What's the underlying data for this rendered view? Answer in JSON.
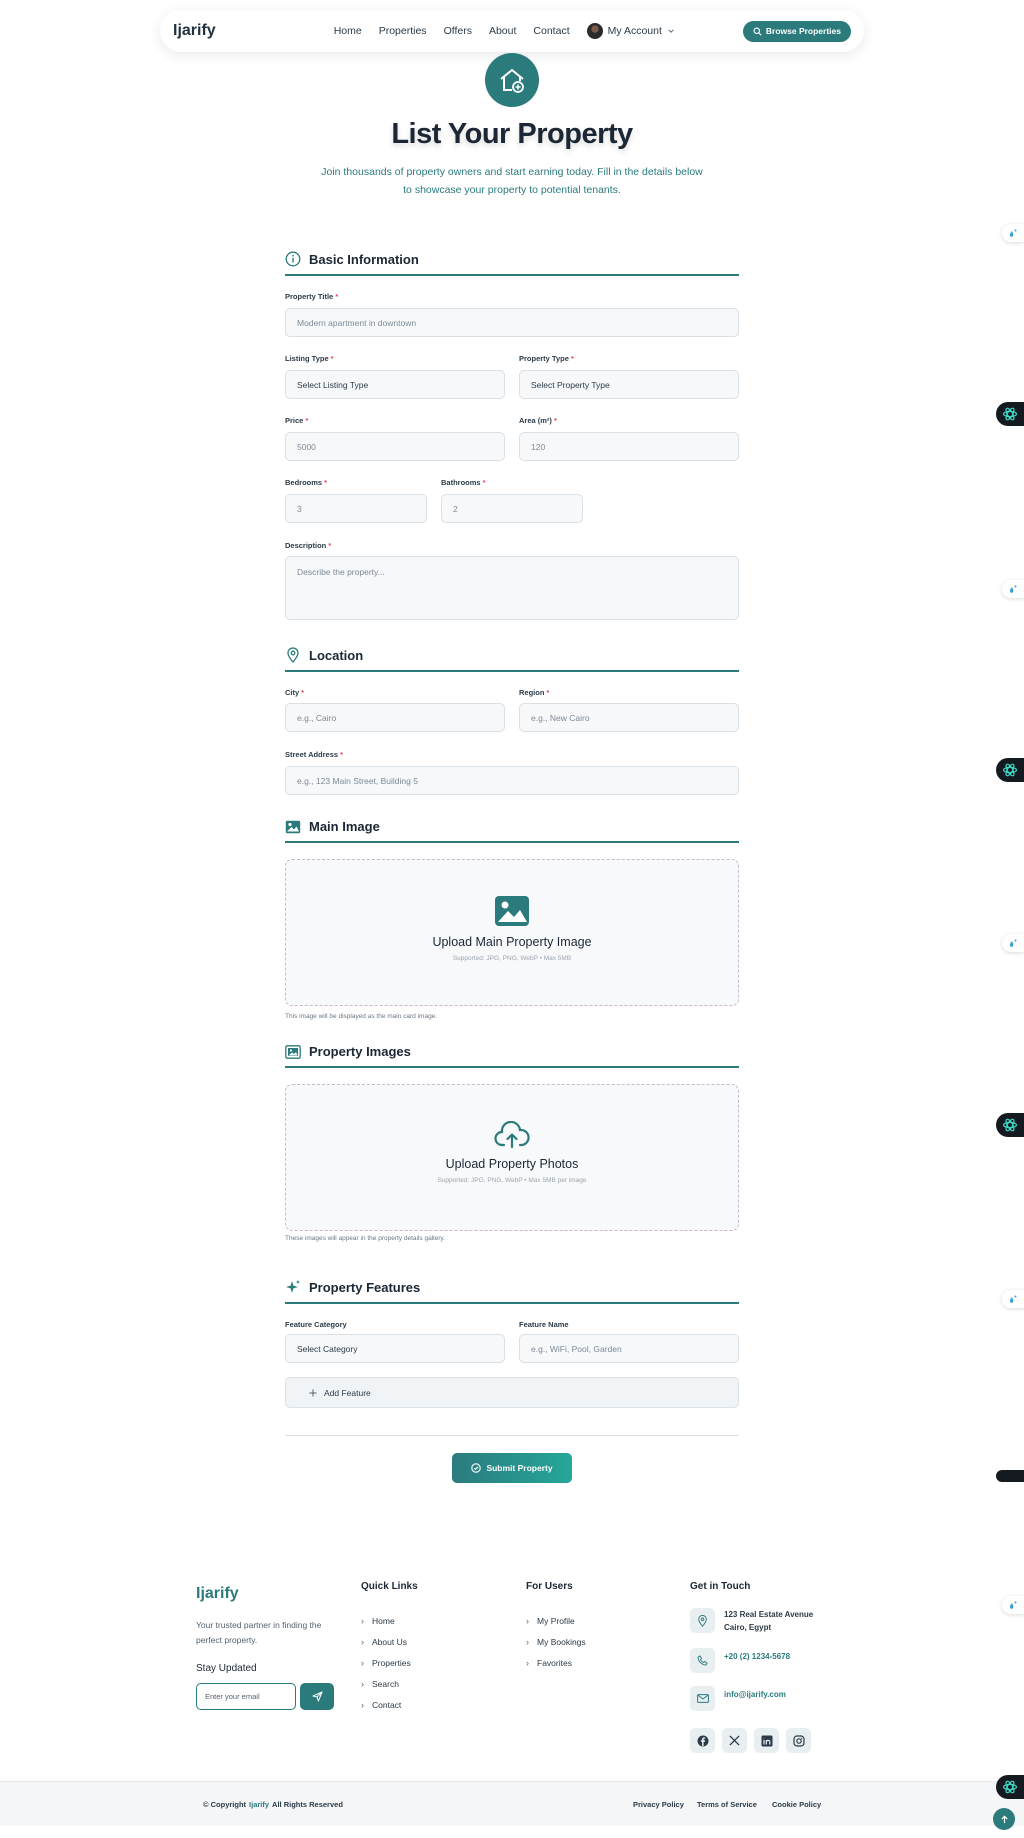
{
  "nav": {
    "logo": "Ijarify",
    "links": [
      "Home",
      "Properties",
      "Offers",
      "About",
      "Contact"
    ],
    "account": "My Account",
    "browse": "Browse Properties"
  },
  "hero": {
    "title": "List Your Property",
    "subtitle": "Join thousands of property owners and start earning today. Fill in the details below to showcase your property to potential tenants."
  },
  "basic": {
    "heading": "Basic Information",
    "title_label": "Property Title",
    "title_placeholder": "Modern apartment in downtown",
    "listing_label": "Listing Type",
    "listing_value": "Select Listing Type",
    "ptype_label": "Property Type",
    "ptype_value": "Select Property Type",
    "price_label": "Price",
    "price_placeholder": "5000",
    "area_label": "Area (m²)",
    "area_placeholder": "120",
    "bedrooms_label": "Bedrooms",
    "bedrooms_placeholder": "3",
    "bathrooms_label": "Bathrooms",
    "bathrooms_placeholder": "2",
    "desc_label": "Description",
    "desc_placeholder": "Describe the property..."
  },
  "location": {
    "heading": "Location",
    "city_label": "City",
    "city_placeholder": "e.g., Cairo",
    "region_label": "Region",
    "region_placeholder": "e.g., New Cairo",
    "street_label": "Street Address",
    "street_placeholder": "e.g., 123 Main Street, Building 5"
  },
  "main_image": {
    "heading": "Main Image",
    "upload_title": "Upload Main Property Image",
    "upload_hint": "Supported: JPG, PNG, WebP • Max 5MB",
    "note": "This image will be displayed as the main card image."
  },
  "images": {
    "heading": "Property Images",
    "upload_title": "Upload Property Photos",
    "upload_hint": "Supported: JPG, PNG, WebP • Max 5MB per image",
    "note": "These images will appear in the property details gallery."
  },
  "features": {
    "heading": "Property Features",
    "category_label": "Feature Category",
    "category_value": "Select Category",
    "name_label": "Feature Name",
    "name_placeholder": "e.g., WiFi, Pool, Garden",
    "add": "Add Feature"
  },
  "submit": "Submit Property",
  "required_mark": "*",
  "footer": {
    "logo": "Ijarify",
    "tagline": "Your trusted partner in finding the perfect property.",
    "stay": "Stay Updated",
    "email_placeholder": "Enter your email",
    "quick_title": "Quick Links",
    "quick_links": [
      "Home",
      "About Us",
      "Properties",
      "Search",
      "Contact"
    ],
    "users_title": "For Users",
    "user_links": [
      "My Profile",
      "My Bookings",
      "Favorites"
    ],
    "touch_title": "Get in Touch",
    "address_line1": "123 Real Estate Avenue",
    "address_line2": "Cairo, Egypt",
    "phone": "+20 (2) 1234-5678",
    "email": "info@ijarify.com",
    "copyright_prefix": "© Copyright",
    "copyright_brand": "Ijarify",
    "copyright_suffix": "All Rights Reserved",
    "privacy": "Privacy Policy",
    "terms": "Terms of Service",
    "cookie": "Cookie Policy"
  },
  "colors": {
    "accent": "#2b7b7d",
    "required": "#e04a5a"
  }
}
